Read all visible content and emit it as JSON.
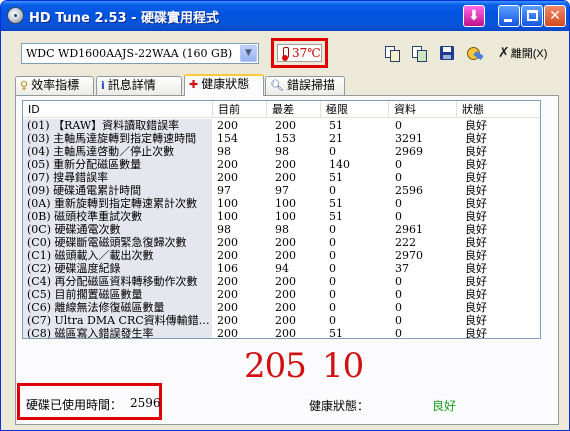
{
  "window": {
    "title": "HD Tune 2.53 - 硬碟實用程式"
  },
  "toolbar": {
    "drive": "WDC WD1600AAJS-22WAA (160 GB)",
    "temperature": "37℃",
    "exit_label": "離開(X)"
  },
  "tabs": [
    {
      "label": "效率指標",
      "icon": "benchmark-icon"
    },
    {
      "label": "訊息詳情",
      "icon": "info-icon"
    },
    {
      "label": "健康狀態",
      "icon": "health-cross-icon",
      "active": true
    },
    {
      "label": "錯誤掃描",
      "icon": "magnifier-icon"
    }
  ],
  "table": {
    "headers": [
      "ID",
      "目前",
      "最差",
      "極限",
      "資料",
      "狀態"
    ],
    "rows": [
      {
        "id": "(01) 【RAW】資料讀取錯誤率",
        "current": "200",
        "worst": "200",
        "threshold": "51",
        "data": "0",
        "status": "良好"
      },
      {
        "id": "(03) 主軸馬達旋轉到指定轉速時間",
        "current": "154",
        "worst": "153",
        "threshold": "21",
        "data": "3291",
        "status": "良好"
      },
      {
        "id": "(04) 主軸馬達啓動／停止次數",
        "current": "98",
        "worst": "98",
        "threshold": "0",
        "data": "2969",
        "status": "良好"
      },
      {
        "id": "(05) 重新分配磁區數量",
        "current": "200",
        "worst": "200",
        "threshold": "140",
        "data": "0",
        "status": "良好"
      },
      {
        "id": "(07) 搜尋錯誤率",
        "current": "200",
        "worst": "200",
        "threshold": "51",
        "data": "0",
        "status": "良好"
      },
      {
        "id": "(09) 硬碟通電累計時間",
        "current": "97",
        "worst": "97",
        "threshold": "0",
        "data": "2596",
        "status": "良好"
      },
      {
        "id": "(0A) 重新旋轉到指定轉速累計次數",
        "current": "100",
        "worst": "100",
        "threshold": "51",
        "data": "0",
        "status": "良好"
      },
      {
        "id": "(0B) 磁頭校準重試次數",
        "current": "100",
        "worst": "100",
        "threshold": "51",
        "data": "0",
        "status": "良好"
      },
      {
        "id": "(0C) 硬碟通電次數",
        "current": "98",
        "worst": "98",
        "threshold": "0",
        "data": "2961",
        "status": "良好"
      },
      {
        "id": "(C0) 硬碟斷電磁頭緊急復歸次數",
        "current": "200",
        "worst": "200",
        "threshold": "0",
        "data": "222",
        "status": "良好"
      },
      {
        "id": "(C1) 磁頭載入／載出次數",
        "current": "200",
        "worst": "200",
        "threshold": "0",
        "data": "2970",
        "status": "良好"
      },
      {
        "id": "(C2) 硬碟溫度紀錄",
        "current": "106",
        "worst": "94",
        "threshold": "0",
        "data": "37",
        "status": "良好"
      },
      {
        "id": "(C4) 再分配磁區資料轉移動作次數",
        "current": "200",
        "worst": "200",
        "threshold": "0",
        "data": "0",
        "status": "良好"
      },
      {
        "id": "(C5) 目前擱置磁區數量",
        "current": "200",
        "worst": "200",
        "threshold": "0",
        "data": "0",
        "status": "良好"
      },
      {
        "id": "(C6) 離線無法修復磁區數量",
        "current": "200",
        "worst": "200",
        "threshold": "0",
        "data": "0",
        "status": "良好"
      },
      {
        "id": "(C7) Ultra DMA CRC資料傳輸錯…",
        "current": "200",
        "worst": "200",
        "threshold": "0",
        "data": "0",
        "status": "良好"
      },
      {
        "id": "(C8) 磁區寫入錯誤發生率",
        "current": "200",
        "worst": "200",
        "threshold": "51",
        "data": "0",
        "status": "良好"
      }
    ]
  },
  "annotations": {
    "left": "205",
    "right": "10"
  },
  "footer": {
    "power_on_label": "硬碟已使用時間：",
    "power_on_value": "2596",
    "health_label": "健康狀態：",
    "health_value": "良好"
  },
  "colors": {
    "highlight_red": "#e00000",
    "good_green": "#1aa01a",
    "titlebar_blue": "#0053e1"
  }
}
